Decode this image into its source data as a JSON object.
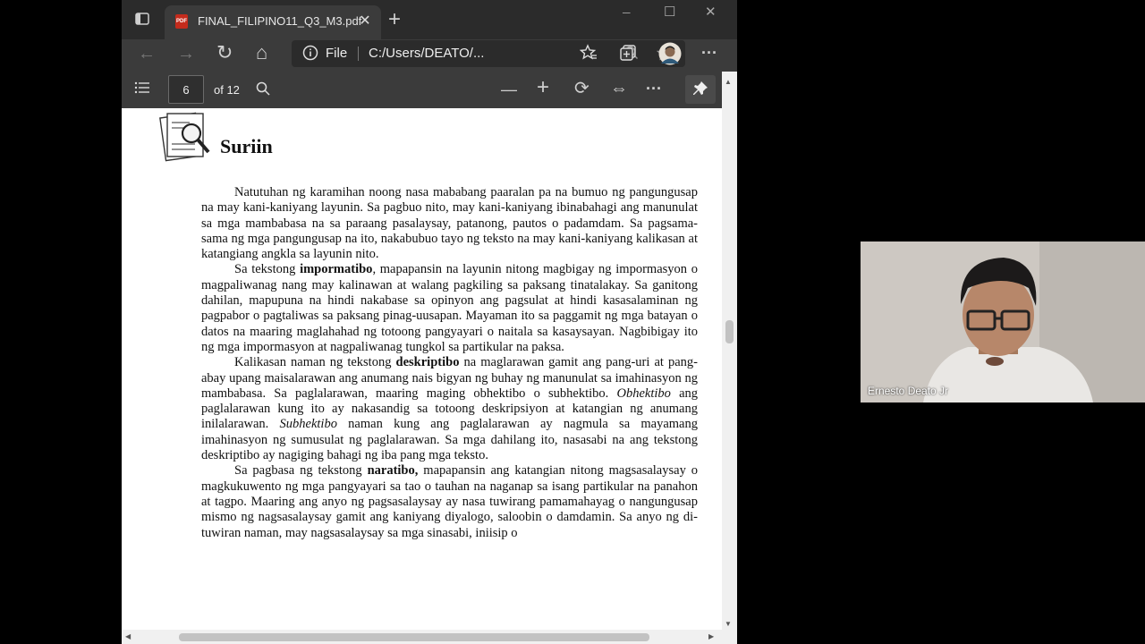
{
  "browser": {
    "tab": {
      "title": "FINAL_FILIPINO11_Q3_M3.pdf",
      "close": "✕",
      "badge": "PDF"
    },
    "new_tab": "+",
    "window": {
      "minimize": "─",
      "maximize": "☐",
      "close": "✕"
    },
    "nav": {
      "back": "←",
      "forward": "→",
      "refresh": "↻",
      "home": "⌂",
      "more": "···"
    },
    "address": {
      "scheme_label": "File",
      "url": "C:/Users/DEATO/..."
    }
  },
  "pdf_toolbar": {
    "current_page": "6",
    "of_pages": "of 12",
    "zoom_out": "—",
    "zoom_in": "+",
    "rotate": "⟳",
    "fit": "⇔",
    "more": "···"
  },
  "document": {
    "section_title": "Suriin",
    "paragraphs": [
      [
        {
          "t": "Natutuhan ng karamihan noong nasa mababang paaralan pa na bumuo ng pangungusap na may kani-kaniyang layunin. Sa pagbuo nito, may kani-kaniyang ibinabahagi ang manunulat sa mga mambabasa na sa paraang pasalaysay, patanong, pautos o padamdam. Sa pagsama-sama ng mga pangungusap na ito, nakabubuo tayo ng teksto na may kani-kaniyang kalikasan at katangiang angkla sa layunin nito."
        }
      ],
      [
        {
          "t": "Sa tekstong "
        },
        {
          "t": "impormatibo",
          "s": "b"
        },
        {
          "t": ", mapapansin na layunin nitong magbigay ng impormasyon o magpaliwanag nang may kalinawan at walang pagkiling sa paksang tinatalakay. Sa ganitong dahilan, mapupuna na hindi nakabase sa opinyon ang pagsulat at hindi kasasalaminan ng pagpabor o pagtaliwas sa paksang pinag-uusapan. Mayaman ito sa paggamit ng mga batayan o datos na maaring maglahahad ng totoong pangyayari o naitala sa kasaysayan. Nagbibigay ito ng mga impormasyon at nagpaliwanag tungkol sa partikular na paksa."
        }
      ],
      [
        {
          "t": "Kalikasan naman ng tekstong "
        },
        {
          "t": "deskriptibo",
          "s": "b"
        },
        {
          "t": " na maglarawan gamit ang pang-uri at pang-abay upang maisalarawan ang anumang nais bigyan ng buhay ng manunulat sa imahinasyon ng mambabasa. Sa paglalarawan, maaring maging obhektibo o subhektibo. "
        },
        {
          "t": "Obhektibo",
          "s": "i"
        },
        {
          "t": " ang paglalarawan kung ito ay nakasandig sa totoong deskripsiyon at katangian ng anumang inilalarawan. "
        },
        {
          "t": "Subhektibo",
          "s": "i"
        },
        {
          "t": " naman kung ang paglalarawan ay nagmula sa mayamang imahinasyon ng sumusulat ng paglalarawan. Sa mga dahilang ito, nasasabi na ang tekstong deskriptibo ay nagiging bahagi ng iba pang mga teksto."
        }
      ],
      [
        {
          "t": "Sa pagbasa ng tekstong "
        },
        {
          "t": "naratibo,",
          "s": "b"
        },
        {
          "t": " mapapansin ang katangian nitong magsasalaysay o magkukuwento ng mga pangyayari sa tao o tauhan na naganap sa isang partikular na panahon at tagpo. Maaring ang anyo ng pagsasalaysay ay nasa tuwirang pamamahayag o nangungusap mismo ng nagsasalaysay gamit ang kaniyang diyalogo, saloobin o damdamin. Sa anyo ng di-tuwiran naman, may nagsasalaysay sa mga sinasabi, iniisip o"
        }
      ]
    ]
  },
  "webcam": {
    "participant_name": "Ernesto Deato Jr"
  },
  "colors": {
    "chrome_dark": "#2b2b2b",
    "chrome": "#3b3b3b",
    "page": "#ffffff",
    "pdf_red": "#c42b1c"
  }
}
